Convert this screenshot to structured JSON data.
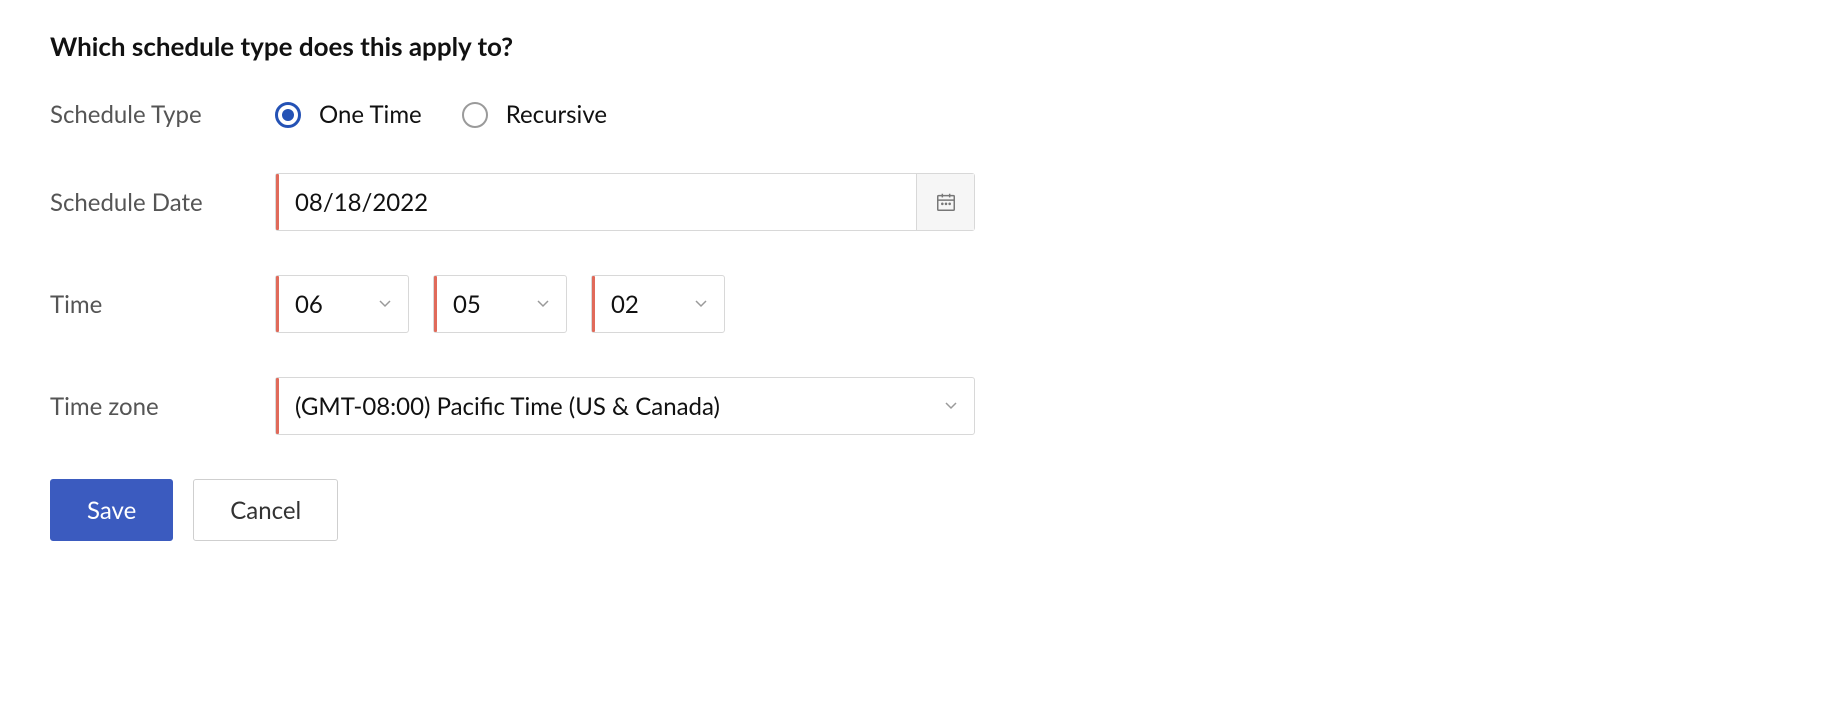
{
  "heading": "Which schedule type does this apply to?",
  "labels": {
    "schedule_type": "Schedule Type",
    "schedule_date": "Schedule Date",
    "time": "Time",
    "time_zone": "Time zone"
  },
  "schedule_type": {
    "options": {
      "one_time": "One Time",
      "recursive": "Recursive"
    },
    "selected": "one_time"
  },
  "schedule_date": {
    "value": "08/18/2022"
  },
  "time": {
    "hour": "06",
    "minute": "05",
    "second": "02"
  },
  "time_zone": {
    "value": "(GMT-08:00) Pacific Time (US & Canada)"
  },
  "buttons": {
    "save": "Save",
    "cancel": "Cancel"
  },
  "colors": {
    "primary": "#3b5bbf",
    "required_mark": "#e06a5a",
    "radio_checked": "#2452b5"
  }
}
